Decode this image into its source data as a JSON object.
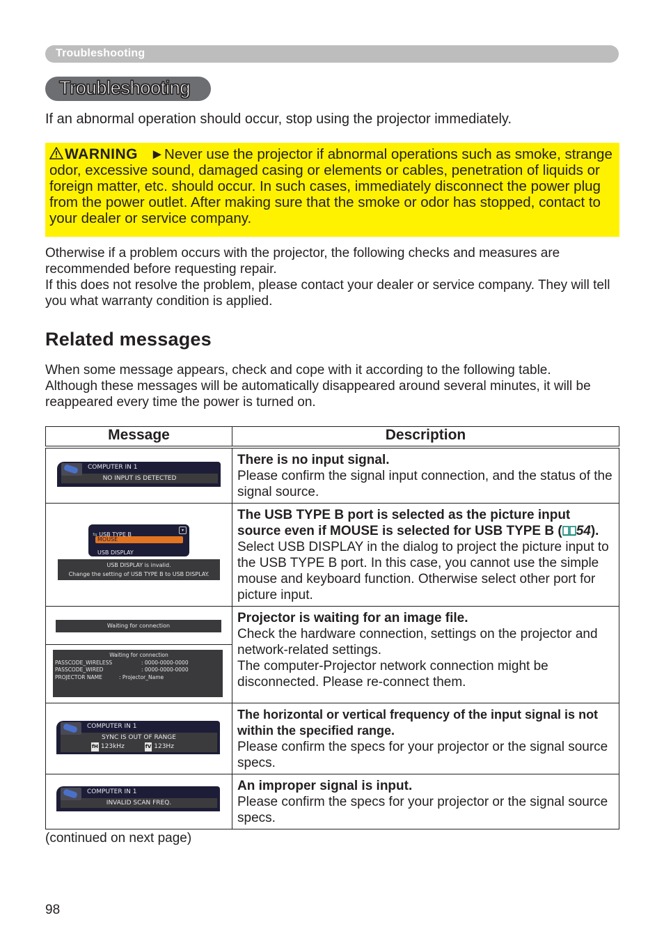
{
  "running_header": "Troubleshooting",
  "section_title": "Troubleshooting",
  "intro": "If an abnormal operation should occur, stop using the projector immediately.",
  "warning": {
    "icon": "warning-triangle-icon",
    "label": "WARNING",
    "arrow": "►",
    "text": "Never use the projector if abnormal operations such as smoke, strange odor, excessive sound, damaged casing or elements or cables, penetration of liquids or foreign matter, etc. should occur. In such cases, immediately disconnect the power plug from the power outlet. After making sure that the smoke or odor has stopped, contact to your dealer or service company.",
    "background_color": "#fff200"
  },
  "otherwise_paragraph": {
    "line1": "Otherwise if a problem occurs with the projector, the following checks and measures are recommended before requesting repair.",
    "line2": "If this does not resolve the problem, please contact your dealer or service company. They will tell you what warranty condition is applied."
  },
  "related_title": "Related messages",
  "related_intro": {
    "line1": "When some message appears, check and cope with it according to the following table.",
    "line2": "Although these messages will be automatically disappeared around several minutes, it will be reappeared every time the power is turned on."
  },
  "table": {
    "headers": [
      "Message",
      "Description"
    ],
    "rows": [
      {
        "osd": {
          "source": "COMPUTER IN 1",
          "message": "NO INPUT IS DETECTED"
        },
        "title": "There is no input signal.",
        "body": "Please confirm the signal input connection, and the status of the signal source."
      },
      {
        "osd": {
          "menu_title": "USB TYPE B",
          "options": [
            "MOUSE",
            "USB DISPLAY"
          ],
          "selected": "MOUSE",
          "notice_line1": "USB DISPLAY is invalid.",
          "notice_line2": "Change the setting of USB TYPE B to USB DISPLAY."
        },
        "title": "The USB TYPE B port is selected as the picture input source even if MOUSE is selected for USB TYPE B",
        "ref_icon": "book-icon",
        "ref_page": "54",
        "body": "Select USB DISPLAY in the dialog to project the picture input to the USB TYPE B port. In this case, you cannot use the simple mouse and keyboard function. Otherwise select other port for picture input."
      },
      {
        "osd_simple": "Waiting for connection",
        "osd_detail": {
          "title": "Waiting for connection",
          "lines": [
            {
              "label": "PASSCODE_WIRELESS",
              "value": ": 0000-0000-0000"
            },
            {
              "label": "PASSCODE_WIRED",
              "value": ": 0000-0000-0000"
            },
            {
              "label": "PROJECTOR NAME",
              "value": ": Projector_Name"
            }
          ]
        },
        "title": "Projector is waiting for an image file.",
        "body1": "Check the hardware connection, settings on the projector and network-related settings.",
        "body2": "The computer-Projector network connection might be disconnected. Please re-connect them."
      },
      {
        "osd": {
          "source": "COMPUTER IN 1",
          "message": "SYNC IS OUT OF RANGE",
          "fh_label": "fH",
          "fh": "123kHz",
          "fv_label": "fV",
          "fv": "123Hz"
        },
        "title": "The horizontal or vertical frequency of the input signal is not within the specified range.",
        "body": "Please confirm the specs for your projector or the signal source specs."
      },
      {
        "osd": {
          "source": "COMPUTER IN 1",
          "message": "INVALID SCAN FREQ."
        },
        "title": "An improper signal is input.",
        "body": "Please confirm the specs for your projector or the signal source specs."
      }
    ]
  },
  "continued": "(continued on next page)",
  "page_number": "98"
}
